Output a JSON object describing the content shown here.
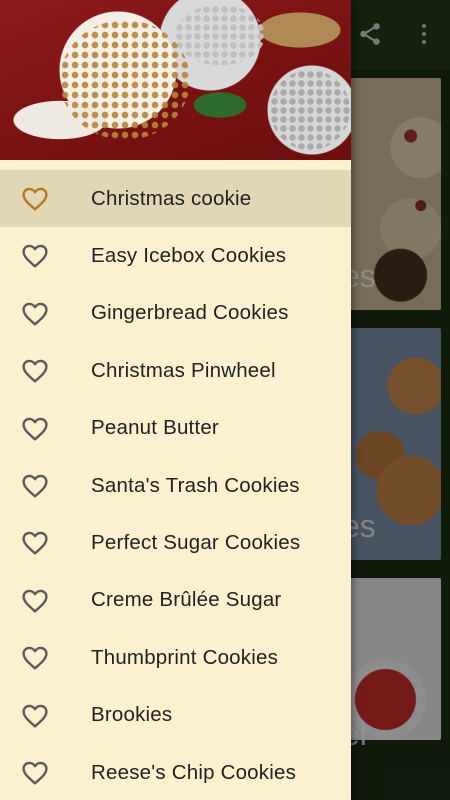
{
  "background": {
    "card_labels": [
      "es",
      "es",
      "el"
    ]
  },
  "drawer": {
    "items": [
      {
        "label": "Christmas cookie",
        "icon": "heart-outline-icon",
        "selected": true
      },
      {
        "label": "Easy Icebox Cookies",
        "icon": "heart-outline-icon"
      },
      {
        "label": "Gingerbread Cookies",
        "icon": "heart-outline-icon"
      },
      {
        "label": "Christmas Pinwheel",
        "icon": "heart-outline-icon"
      },
      {
        "label": "Peanut Butter",
        "icon": "heart-outline-icon"
      },
      {
        "label": "Santa's Trash Cookies",
        "icon": "heart-outline-icon"
      },
      {
        "label": "Perfect Sugar Cookies",
        "icon": "heart-outline-icon"
      },
      {
        "label": "Creme Brûlée Sugar",
        "icon": "heart-outline-icon"
      },
      {
        "label": "Thumbprint Cookies",
        "icon": "heart-outline-icon"
      },
      {
        "label": "Brookies",
        "icon": "heart-outline-icon"
      },
      {
        "label": "Reese's Chip Cookies",
        "icon": "heart-outline-icon"
      }
    ]
  },
  "colors": {
    "drawer_bg": "#fbf1cf",
    "selected_bg": "#e1d7b4",
    "heart_selected": "#b8751c",
    "heart_default": "#5a5a5a",
    "app_bar": "#213a18"
  }
}
